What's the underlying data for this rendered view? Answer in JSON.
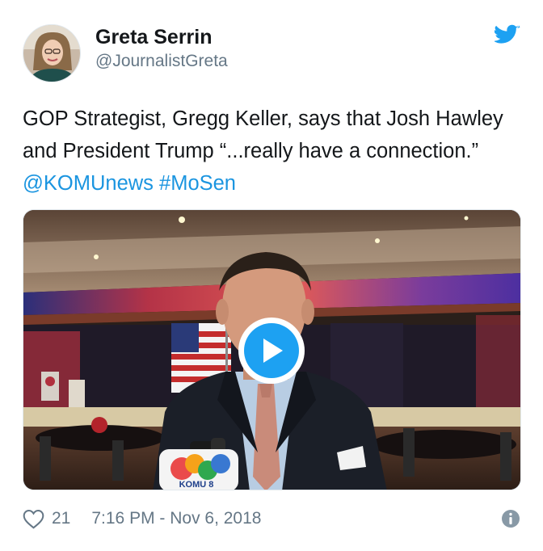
{
  "user": {
    "name": "Greta Serrin",
    "handle": "@JournalistGreta"
  },
  "tweet": {
    "text": "GOP Strategist, Gregg Keller, says that Josh Hawley and President Trump “...really have a connection.”",
    "mentions": [
      "@KOMUnews",
      "#MoSen"
    ]
  },
  "media": {
    "type": "video",
    "station_logo_text": "KOMU 8"
  },
  "footer": {
    "likes": "21",
    "timestamp": "7:16 PM - Nov 6, 2018"
  },
  "icons": {
    "bird": "twitter-bird-icon",
    "heart": "heart-icon",
    "info": "info-icon",
    "play": "play-icon"
  },
  "colors": {
    "accent": "#1da1f2",
    "link": "#1b95e0",
    "text": "#14171a",
    "muted": "#657786"
  }
}
